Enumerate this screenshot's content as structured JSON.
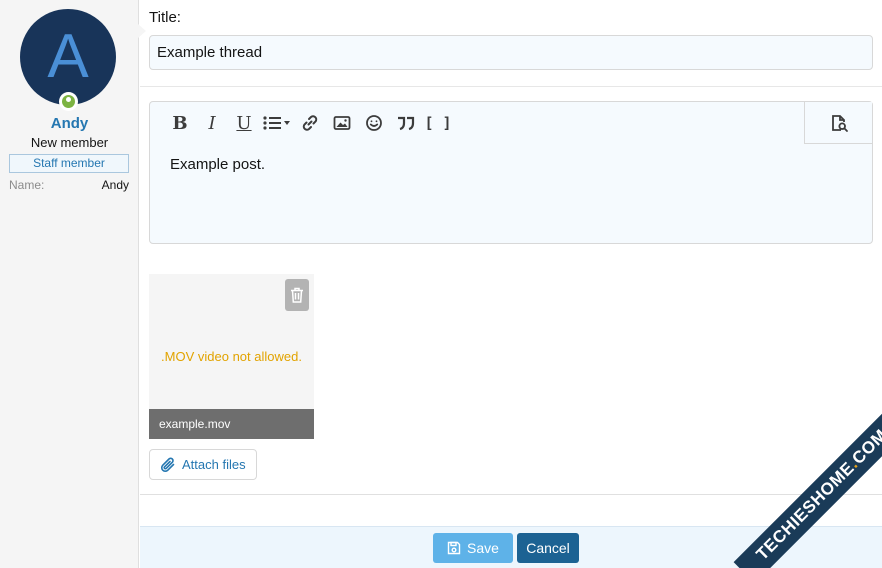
{
  "user": {
    "avatar_letter": "A",
    "name": "Andy",
    "title": "New member",
    "banner": "Staff member",
    "extra_label": "Name:",
    "extra_value": "Andy",
    "online_color": "#7cb342"
  },
  "form": {
    "title_label": "Title:",
    "title_value": "Example thread",
    "body_text": "Example post."
  },
  "toolbar": {
    "buttons": [
      "bold-icon",
      "italic-icon",
      "underline-icon",
      "list-icon",
      "link-icon",
      "image-icon",
      "smilie-icon",
      "quote-icon",
      "code-icon"
    ],
    "bold_glyph": "B",
    "italic_glyph": "I",
    "underline_glyph": "U",
    "code_glyph": "[ ]",
    "preview_icon": "preview-icon"
  },
  "attachment": {
    "error": ".MOV video not allowed.",
    "filename": "example.mov",
    "error_color": "#e2a300"
  },
  "actions": {
    "attach_label": "Attach files",
    "save_label": "Save",
    "cancel_label": "Cancel"
  },
  "watermark": {
    "text_a": "TECHIESHOME",
    "text_dot": ".",
    "text_b": "COM"
  },
  "colors": {
    "link": "#2577b1",
    "save": "#5eb2e8",
    "cancel": "#1c6293",
    "avatar_bg": "#183459"
  }
}
